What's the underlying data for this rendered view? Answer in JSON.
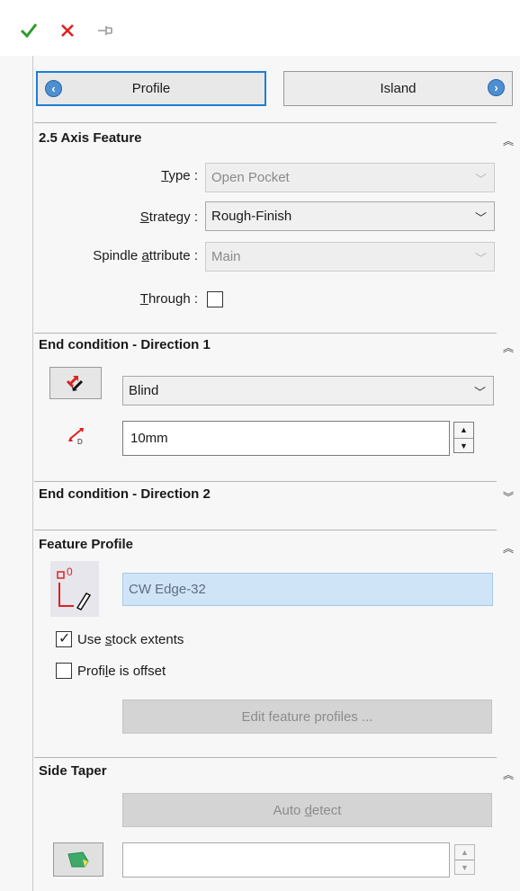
{
  "toolbar": {
    "ok_icon": "checkmark-icon",
    "cancel_icon": "x-icon",
    "pin_icon": "pushpin-icon"
  },
  "tabs": {
    "profile": "Profile",
    "island": "Island"
  },
  "axis_feature": {
    "title": "2.5 Axis Feature",
    "type_label": "Type :",
    "type_value": "Open Pocket",
    "strategy_label": "Strategy :",
    "strategy_value": "Rough-Finish",
    "spindle_label": "Spindle attribute :",
    "spindle_value": "Main",
    "through_label": "Through :",
    "through_checked": false
  },
  "end_condition_1": {
    "title": "End condition - Direction 1",
    "condition_value": "Blind",
    "depth_value": "10mm"
  },
  "end_condition_2": {
    "title": "End condition - Direction 2"
  },
  "feature_profile": {
    "title": "Feature Profile",
    "profile_value": "CW Edge-32",
    "profile_icon_badge": "0",
    "use_stock_label": "Use stock extents",
    "use_stock_checked": true,
    "offset_label": "Profile is offset",
    "offset_checked": false,
    "edit_button": "Edit feature profiles ..."
  },
  "side_taper": {
    "title": "Side Taper",
    "auto_detect": "Auto detect",
    "taper_value": ""
  },
  "colors": {
    "accent": "#1d7ed6",
    "ok_green": "#2e9b2e",
    "cancel_red": "#e02020",
    "selection_blue": "#cfe4f7"
  }
}
